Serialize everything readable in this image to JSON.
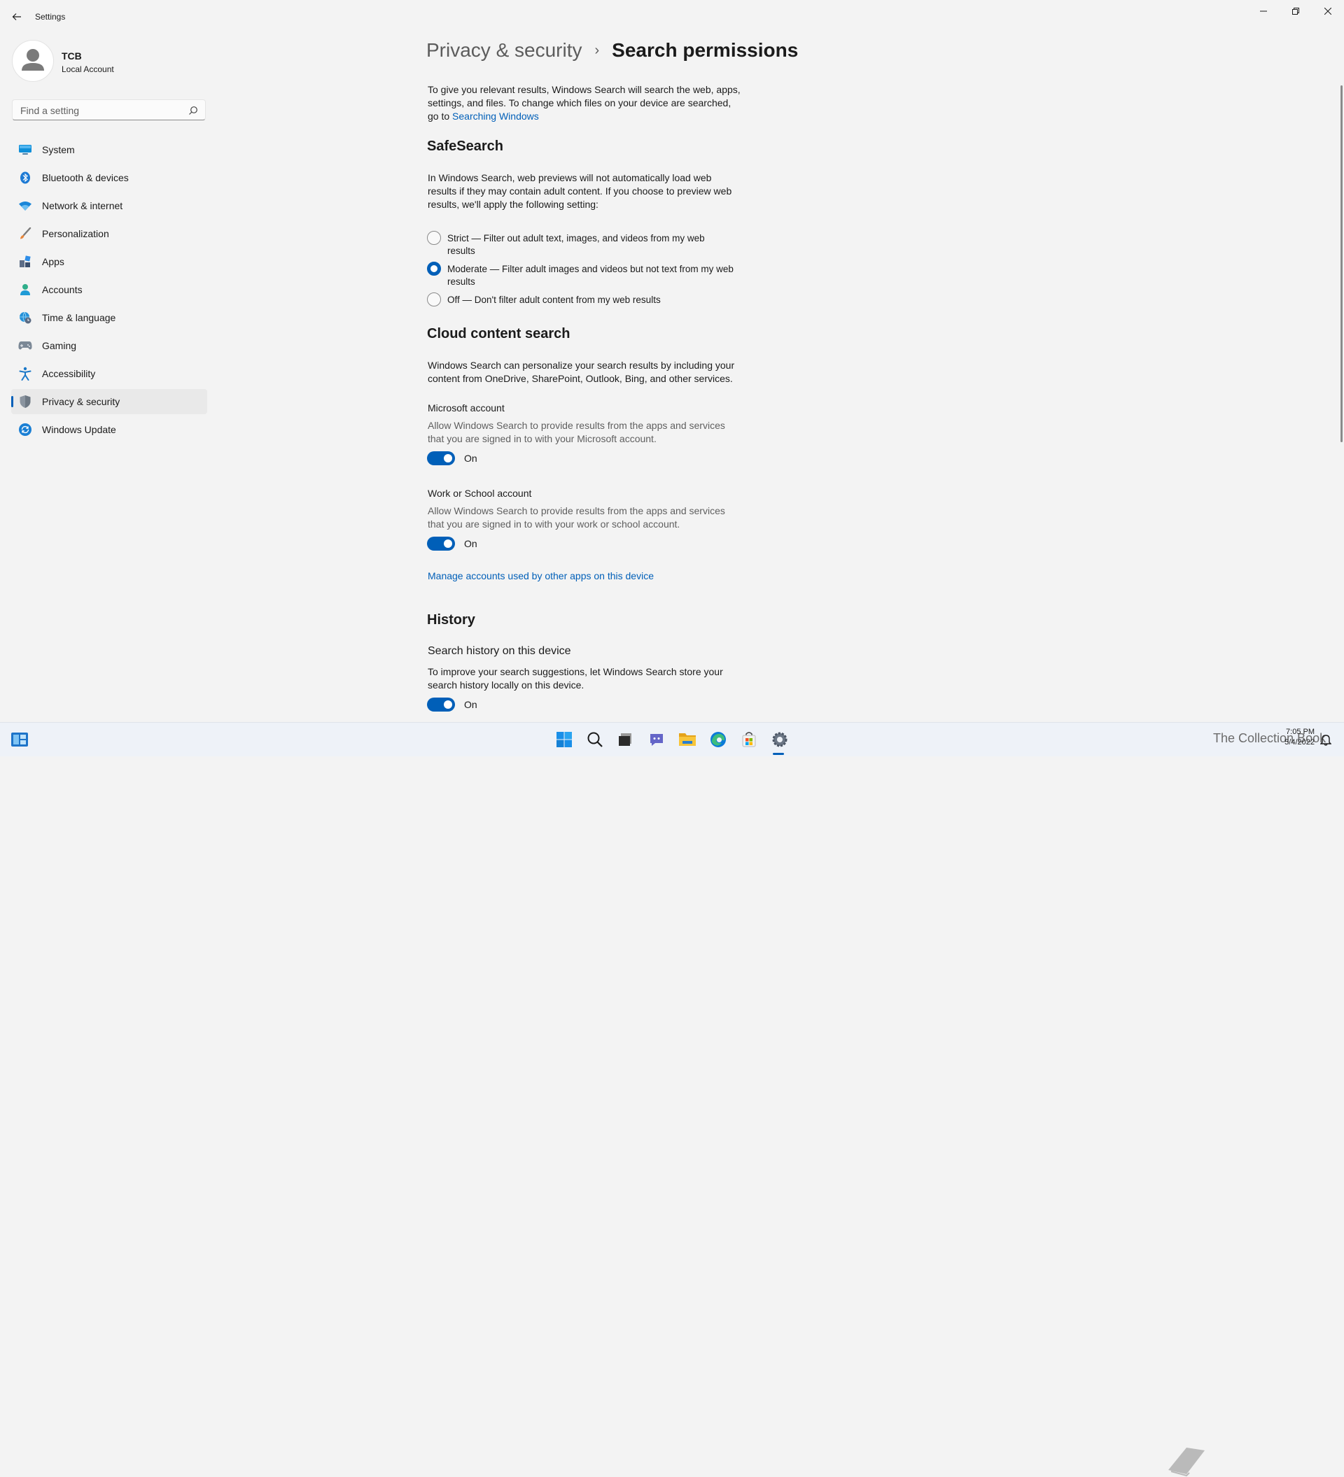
{
  "window": {
    "title": "Settings",
    "icons": {
      "back": "back-arrow-icon",
      "minimize": "minimize-icon",
      "restore": "restore-icon",
      "close": "close-icon"
    }
  },
  "user": {
    "name": "TCB",
    "account_type": "Local Account"
  },
  "search": {
    "placeholder": "Find a setting"
  },
  "sidebar": {
    "items": [
      {
        "label": "System",
        "icon": "monitor-icon"
      },
      {
        "label": "Bluetooth & devices",
        "icon": "bluetooth-icon"
      },
      {
        "label": "Network & internet",
        "icon": "wifi-icon"
      },
      {
        "label": "Personalization",
        "icon": "brush-icon"
      },
      {
        "label": "Apps",
        "icon": "apps-icon"
      },
      {
        "label": "Accounts",
        "icon": "person-icon"
      },
      {
        "label": "Time & language",
        "icon": "globe-clock-icon"
      },
      {
        "label": "Gaming",
        "icon": "gamepad-icon"
      },
      {
        "label": "Accessibility",
        "icon": "accessibility-icon"
      },
      {
        "label": "Privacy & security",
        "icon": "shield-icon",
        "active": true
      },
      {
        "label": "Windows Update",
        "icon": "update-icon"
      }
    ]
  },
  "breadcrumb": {
    "parent": "Privacy & security",
    "separator": "›",
    "current": "Search permissions"
  },
  "intro": {
    "text": "To give you relevant results, Windows Search will search the web, apps, settings, and files. To change which files on your device are searched, go to",
    "link": "Searching Windows"
  },
  "safesearch": {
    "title": "SafeSearch",
    "description": "In Windows Search, web previews will not automatically load web results if they may contain adult content. If you choose to preview web results, we'll apply the following setting:",
    "options": [
      {
        "label": "Strict — Filter out adult text, images, and videos from my web results",
        "selected": false
      },
      {
        "label": "Moderate — Filter adult images and videos but not text from my web results",
        "selected": true
      },
      {
        "label": "Off — Don't filter adult content from my web results",
        "selected": false
      }
    ]
  },
  "cloud": {
    "title": "Cloud content search",
    "description": "Windows Search can personalize your search results by including your content from OneDrive, SharePoint, Outlook, Bing, and other services.",
    "microsoft": {
      "title": "Microsoft account",
      "description": "Allow Windows Search to provide results from the apps and services that you are signed in to with your Microsoft account.",
      "toggle": "On"
    },
    "work": {
      "title": "Work or School account",
      "description": "Allow Windows Search to provide results from the apps and services that you are signed in to with your work or school account.",
      "toggle": "On"
    },
    "manage_link": "Manage accounts used by other apps on this device"
  },
  "history": {
    "title": "History",
    "sub_title": "Search history on this device",
    "description": "To improve your search suggestions, let Windows Search store your search history locally on this device.",
    "toggle": "On"
  },
  "taskbar": {
    "icons": [
      "widgets-icon",
      "start-icon",
      "search-icon",
      "task-view-icon",
      "chat-icon",
      "file-explorer-icon",
      "edge-icon",
      "store-icon",
      "settings-gear-icon"
    ],
    "watermark": "The Collection Book",
    "time": "7:05 PM",
    "date": "5/4/2022"
  },
  "colors": {
    "accent": "#005fb8",
    "background": "#f3f3f3",
    "taskbar": "#eef2f8"
  }
}
